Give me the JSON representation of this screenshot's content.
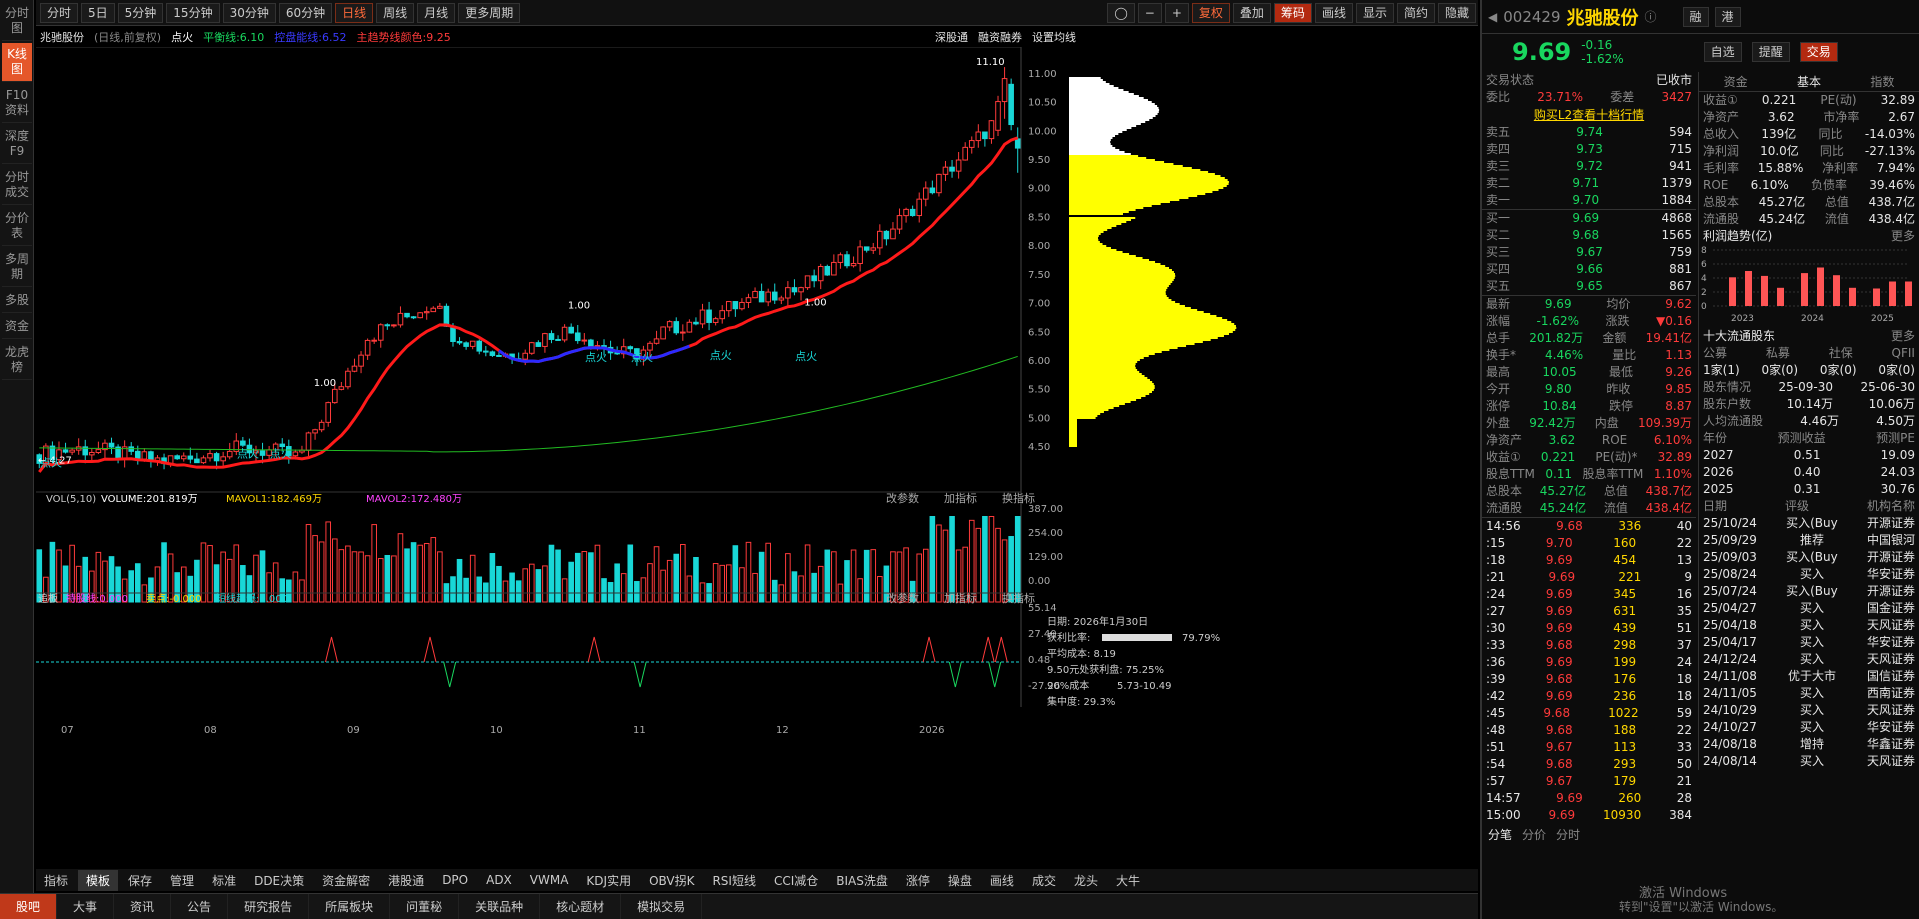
{
  "leftbar": [
    "分时图",
    "K线图",
    "F10资料",
    "深度F9",
    "分时成交",
    "分价表",
    "多周期",
    "多股",
    "资金",
    "龙虎榜"
  ],
  "toolbar": {
    "periods": [
      "分时",
      "5日",
      "5分钟",
      "15分钟",
      "30分钟",
      "60分钟",
      "日线",
      "周线",
      "月线",
      "更多周期"
    ],
    "active": "日线",
    "right": [
      "复权",
      "叠加",
      "筹码",
      "画线",
      "显示",
      "简约",
      "隐藏"
    ],
    "icons": [
      "lock-icon",
      "minus-icon",
      "plus-icon"
    ]
  },
  "infoline": {
    "name": "兆驰股份",
    "mode": "(日线,前复权)",
    "dianhuo": "点火",
    "pingheng": "平衡线:6.10",
    "huokong": "控盘能线:6.52",
    "zhuqushi": "主趋势线颜色:9.25",
    "links": [
      "深股通",
      "融资融券",
      "设置均线"
    ]
  },
  "price_axis": [
    "11.00",
    "10.50",
    "10.00",
    "9.50",
    "9.00",
    "8.50",
    "8.00",
    "7.50",
    "7.00",
    "6.50",
    "6.00",
    "5.50",
    "5.00",
    "4.50"
  ],
  "vol_axis": [
    "387.00",
    "254.00",
    "129.00",
    "0.00"
  ],
  "ind_axis": [
    "55.14",
    "27.40",
    "0.48",
    "-27.26"
  ],
  "months": [
    "07",
    "08",
    "09",
    "10",
    "11",
    "12",
    "2026"
  ],
  "vol_header": {
    "title": "VOL(5,10)",
    "volume": "VOLUME:201.819万",
    "ma1": "MAVOL1:182.469万",
    "ma2": "MAVOL2:172.480万",
    "links": [
      "改参数",
      "加指标",
      "换指标"
    ]
  },
  "ind_header": {
    "title": "追板",
    "cf": "持股线:0.000",
    "mai": "卖点:-0.000",
    "dx": "短线起爆:0.000",
    "links": [
      "改参数",
      "加指标",
      "换指标"
    ]
  },
  "chips": {
    "date": "日期: 2026年1月30日",
    "profit": "获利比率:",
    "profit_v": "79.79%",
    "avgcost": "平均成本: 8.19",
    "p950": "9.50元处获利盘: 75.25%",
    "cost90": "90%成本",
    "cost90_v": "5.73-10.49",
    "conc": "集中度: 29.3%"
  },
  "annotations": {
    "max": "11.10",
    "min": "4.27",
    "vals": [
      "1.00",
      "1.00",
      "1.00",
      "1.00",
      "1.00"
    ],
    "fire": "点火"
  },
  "bottombar": [
    "指标",
    "模板",
    "保存",
    "管理",
    "标准",
    "DDE决策",
    "资金解密",
    "港股通",
    "DPO",
    "ADX",
    "VWMA",
    "KDJ实用",
    "OBV拐K",
    "RSI短线",
    "CCI减仓",
    "BIAS洗盘",
    "涨停",
    "操盘",
    "画线",
    "成交",
    "龙头",
    "大牛"
  ],
  "pagebar": [
    "股吧",
    "大事",
    "资讯",
    "公告",
    "研究报告",
    "所属板块",
    "问董秘",
    "关联品种",
    "核心题材",
    "模拟交易"
  ],
  "header": {
    "code": "002429",
    "name": "兆驰股份",
    "price": "9.69",
    "chg": "-0.16",
    "pct": "-1.62%",
    "btns": [
      "自选",
      "提醒",
      "交易"
    ],
    "tags": [
      "融",
      "港"
    ]
  },
  "status": {
    "label": "交易状态",
    "value": "已收市",
    "wb": "委比",
    "wb_v": "23.71%",
    "wc": "委差",
    "wc_v": "3427",
    "l2": "购买L2查看十档行情"
  },
  "sells": [
    [
      "卖五",
      "9.74",
      "594"
    ],
    [
      "卖四",
      "9.73",
      "715"
    ],
    [
      "卖三",
      "9.72",
      "941"
    ],
    [
      "卖二",
      "9.71",
      "1379"
    ],
    [
      "卖一",
      "9.70",
      "1884"
    ]
  ],
  "buys": [
    [
      "买一",
      "9.69",
      "4868"
    ],
    [
      "买二",
      "9.68",
      "1565"
    ],
    [
      "买三",
      "9.67",
      "759"
    ],
    [
      "买四",
      "9.66",
      "881"
    ],
    [
      "买五",
      "9.65",
      "867"
    ]
  ],
  "quote": [
    [
      "最新",
      "9.69",
      "均价",
      "9.62"
    ],
    [
      "涨幅",
      "-1.62%",
      "涨跌",
      "▼0.16"
    ],
    [
      "总手",
      "201.82万",
      "金额",
      "19.41亿"
    ],
    [
      "换手*",
      "4.46%",
      "量比",
      "1.13"
    ],
    [
      "最高",
      "10.05",
      "最低",
      "9.26"
    ],
    [
      "今开",
      "9.80",
      "昨收",
      "9.85"
    ],
    [
      "涨停",
      "10.84",
      "跌停",
      "8.87"
    ],
    [
      "外盘",
      "92.42万",
      "内盘",
      "109.39万"
    ],
    [
      "净资产",
      "3.62",
      "ROE",
      "6.10%"
    ],
    [
      "收益①",
      "0.221",
      "PE(动)*",
      "32.89"
    ],
    [
      "股息TTM",
      "0.11",
      "股息率TTM",
      "1.10%"
    ],
    [
      "总股本",
      "45.27亿",
      "总值",
      "438.7亿"
    ],
    [
      "流通股",
      "45.24亿",
      "流值",
      "438.4亿"
    ]
  ],
  "ticks": [
    [
      "14:56",
      "9.68",
      "336",
      "40"
    ],
    [
      ":15",
      "9.70",
      "160",
      "22"
    ],
    [
      ":18",
      "9.69",
      "454",
      "13"
    ],
    [
      ":21",
      "9.69",
      "221",
      "9"
    ],
    [
      ":24",
      "9.69",
      "345",
      "16"
    ],
    [
      ":27",
      "9.69",
      "631",
      "35"
    ],
    [
      ":30",
      "9.69",
      "439",
      "51"
    ],
    [
      ":33",
      "9.68",
      "298",
      "37"
    ],
    [
      ":36",
      "9.69",
      "199",
      "24"
    ],
    [
      ":39",
      "9.68",
      "176",
      "18"
    ],
    [
      ":42",
      "9.69",
      "236",
      "18"
    ],
    [
      ":45",
      "9.68",
      "1022",
      "59"
    ],
    [
      ":48",
      "9.68",
      "188",
      "22"
    ],
    [
      ":51",
      "9.67",
      "113",
      "33"
    ],
    [
      ":54",
      "9.68",
      "293",
      "50"
    ],
    [
      ":57",
      "9.67",
      "179",
      "21"
    ],
    [
      "14:57",
      "9.69",
      "260",
      "28"
    ],
    [
      "15:00",
      "9.69",
      "10930",
      "384"
    ]
  ],
  "ticktabs": [
    "分笔",
    "分价",
    "分时"
  ],
  "fin_tabs": [
    "资金",
    "基本",
    "指数"
  ],
  "fin": [
    [
      "收益①",
      "0.221",
      "PE(动)",
      "32.89"
    ],
    [
      "净资产",
      "3.62",
      "市净率",
      "2.67"
    ],
    [
      "总收入",
      "139亿",
      "同比",
      "-14.03%"
    ],
    [
      "净利润",
      "10.0亿",
      "同比",
      "-27.13%"
    ],
    [
      "毛利率",
      "15.88%",
      "净利率",
      "7.94%"
    ],
    [
      "ROE",
      "6.10%",
      "负债率",
      "39.46%"
    ],
    [
      "总股本",
      "45.27亿",
      "总值",
      "438.7亿"
    ],
    [
      "流通股",
      "45.24亿",
      "流值",
      "438.4亿"
    ]
  ],
  "profit_trend": {
    "title": "利润趋势(亿)",
    "more": "更多",
    "years": [
      "2023",
      "2024",
      "2025"
    ],
    "yaxis": [
      "8",
      "6",
      "4",
      "2",
      "0"
    ],
    "values": [
      4.1,
      5.0,
      4.3,
      2.6,
      4.7,
      5.5,
      4.4,
      2.6,
      2.5,
      3.5,
      3.5
    ]
  },
  "holders": {
    "title": "十大流通股东",
    "more": "更多",
    "cols": [
      "公募",
      "私募",
      "社保",
      "QFII"
    ],
    "vals": [
      "1家(1)",
      "0家(0)",
      "0家(0)",
      "0家(0)"
    ],
    "rows": [
      [
        "股东情况",
        "25-09-30",
        "25-06-30"
      ],
      [
        "股东户数",
        "10.14万",
        "10.06万"
      ],
      [
        "人均流通股",
        "4.46万",
        "4.50万"
      ]
    ]
  },
  "forecast": {
    "cols": [
      "年份",
      "预测收益",
      "预测PE"
    ],
    "rows": [
      [
        "2027",
        "0.51",
        "19.09"
      ],
      [
        "2026",
        "0.40",
        "24.03"
      ],
      [
        "2025",
        "0.31",
        "30.76"
      ]
    ]
  },
  "ratings": {
    "cols": [
      "日期",
      "评级",
      "机构名称"
    ],
    "rows": [
      [
        "25/10/24",
        "买入(Buy",
        "开源证券"
      ],
      [
        "25/09/29",
        "推荐",
        "中国银河"
      ],
      [
        "25/09/03",
        "买入(Buy",
        "开源证券"
      ],
      [
        "25/08/24",
        "买入",
        "华安证券"
      ],
      [
        "25/07/24",
        "买入(Buy",
        "开源证券"
      ],
      [
        "25/04/27",
        "买入",
        "国金证券"
      ],
      [
        "25/04/18",
        "买入",
        "天风证券"
      ],
      [
        "25/04/17",
        "买入",
        "华安证券"
      ],
      [
        "24/12/24",
        "买入",
        "天风证券"
      ],
      [
        "24/11/08",
        "优于大市",
        "国信证券"
      ],
      [
        "24/11/05",
        "买入",
        "西南证券"
      ],
      [
        "24/10/29",
        "买入",
        "天风证券"
      ],
      [
        "24/10/27",
        "买入",
        "华安证券"
      ],
      [
        "24/08/18",
        "增持",
        "华鑫证券"
      ],
      [
        "24/08/14",
        "买入",
        "天风证券"
      ]
    ]
  },
  "watermark": [
    "激活 Windows",
    "转到\"设置\"以激活 Windows。"
  ],
  "colors": {
    "up": "#ff3b3b",
    "down": "#19d7d7",
    "ma": "#ff1a1a",
    "ma_blue": "#2a2aff",
    "long": "#22bb22",
    "chip": "#ffff00"
  }
}
